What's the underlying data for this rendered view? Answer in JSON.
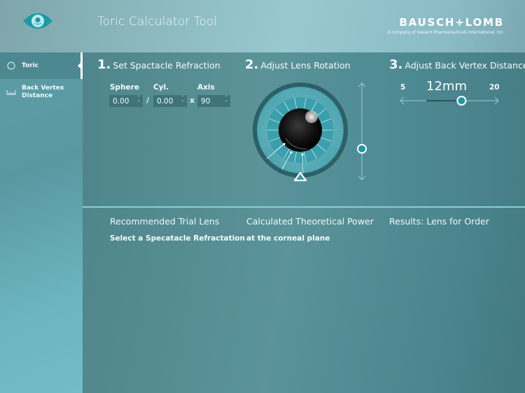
{
  "header": {
    "logo_icon": "eye-icon",
    "title": "Toric Calculator Tool",
    "brand_name": "BAUSCH+LOMB",
    "brand_tagline": "A company of Valeant Pharmaceuticals International, Inc."
  },
  "sidebar": {
    "items": [
      {
        "label": "Toric",
        "icon": "circle-icon",
        "active": true
      },
      {
        "label": "Back Vertex Distance",
        "icon": "ruler-icon",
        "active": false
      }
    ]
  },
  "step1": {
    "number": "1.",
    "title": "Set Spactacle Refraction",
    "sphere_label": "Sphere",
    "sphere_value": "0.00",
    "cyl_label": "Cyl.",
    "cyl_value": "0.00",
    "axis_label": "Axis",
    "axis_value": "90",
    "separator_slash": "/",
    "separator_x": "x"
  },
  "step2": {
    "number": "2.",
    "title": "Adjust Lens Rotation",
    "rotation_slider_position": 0.68
  },
  "step3": {
    "number": "3.",
    "title": "Adjust Back Vertex Distance",
    "value_display": "12mm",
    "min_label": "5",
    "max_label": "20",
    "value": 12,
    "min": 5,
    "max": 20
  },
  "results": {
    "columns": [
      {
        "heading": "Recommended Trial Lens",
        "subtext": "Select a Specatacle Refractation"
      },
      {
        "heading": "Calculated Theoretical Power",
        "subtext": "at the corneal plane"
      },
      {
        "heading": "Results: Lens for Order",
        "subtext": ""
      }
    ]
  },
  "colors": {
    "accent": "#1a9aa6",
    "panel": "#4f868c",
    "divider": "#86cfdb"
  }
}
